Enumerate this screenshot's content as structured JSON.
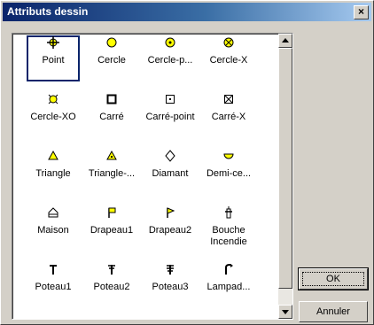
{
  "window": {
    "title": "Attributs dessin",
    "close_label": "×"
  },
  "items": [
    {
      "label": "Point",
      "icon": "point-crosshair-icon",
      "selected": true
    },
    {
      "label": "Cercle",
      "icon": "circle-icon"
    },
    {
      "label": "Cercle-p...",
      "icon": "circle-point-icon"
    },
    {
      "label": "Cercle-X",
      "icon": "circle-x-icon"
    },
    {
      "label": "Cercle-XO",
      "icon": "circle-xo-icon"
    },
    {
      "label": "Carré",
      "icon": "square-icon"
    },
    {
      "label": "Carré-point",
      "icon": "square-point-icon"
    },
    {
      "label": "Carré-X",
      "icon": "square-x-icon"
    },
    {
      "label": "Triangle",
      "icon": "triangle-icon"
    },
    {
      "label": "Triangle-...",
      "icon": "triangle-point-icon"
    },
    {
      "label": "Diamant",
      "icon": "diamond-icon"
    },
    {
      "label": "Demi-ce...",
      "icon": "half-circle-icon"
    },
    {
      "label": "Maison",
      "icon": "house-icon"
    },
    {
      "label": "Drapeau1",
      "icon": "flag1-icon"
    },
    {
      "label": "Drapeau2",
      "icon": "flag2-icon"
    },
    {
      "label": "Bouche\nIncendie",
      "label_line1": "Bouche",
      "label_line2": "Incendie",
      "icon": "hydrant-icon"
    },
    {
      "label": "Poteau1",
      "icon": "pole1-icon"
    },
    {
      "label": "Poteau2",
      "icon": "pole2-icon"
    },
    {
      "label": "Poteau3",
      "icon": "pole3-icon"
    },
    {
      "label": "Lampad...",
      "icon": "streetlamp-icon"
    }
  ],
  "buttons": {
    "ok": "OK",
    "cancel": "Annuler"
  },
  "colors": {
    "symbol_yellow": "#ffff00",
    "title_bar_start": "#0a246a",
    "title_bar_end": "#a6caf0"
  }
}
